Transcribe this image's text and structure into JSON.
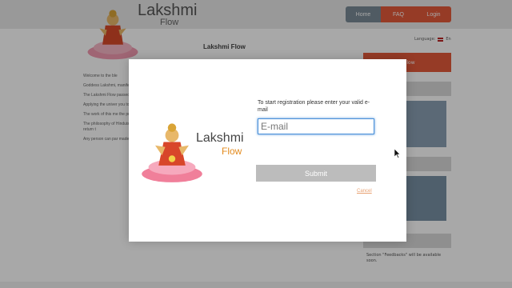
{
  "header": {
    "logo_main": "Lakshmi",
    "logo_sub": "Flow",
    "nav": {
      "home": "Home",
      "faq": "FAQ",
      "login": "Login"
    }
  },
  "language": {
    "label": "Language:",
    "code": "En"
  },
  "content": {
    "title": "Lakshmi Flow",
    "paragraphs": [
      "Welcome to the ble",
      "Goddess Lakshmi, manifestation of it, of life, brings the believer and one w goods.",
      "The Lakshmi Flow passed down from always enough mon arise only because c",
      "Applying the univer you to use your mo",
      "The work of this me the principle of suc",
      "The philosophy of Hinduism for many other, they will alw manifestations of e people will return t",
      "Any person can par made by the higher prosperous life. Lak"
    ]
  },
  "sidebar": {
    "cta_label": "e Flow",
    "feedback_note": "Section \"Feedbacks\" will be available soon."
  },
  "modal": {
    "logo_main": "Lakshmi",
    "logo_sub": "Flow",
    "prompt": "To start registration please enter your valid e-mail",
    "email_placeholder": "E-mail",
    "submit_label": "Submit",
    "cancel_label": "Cancel"
  },
  "colors": {
    "accent": "#e45a3b",
    "logo_orange": "#e38b1f",
    "focus_blue": "#4a90d9"
  }
}
